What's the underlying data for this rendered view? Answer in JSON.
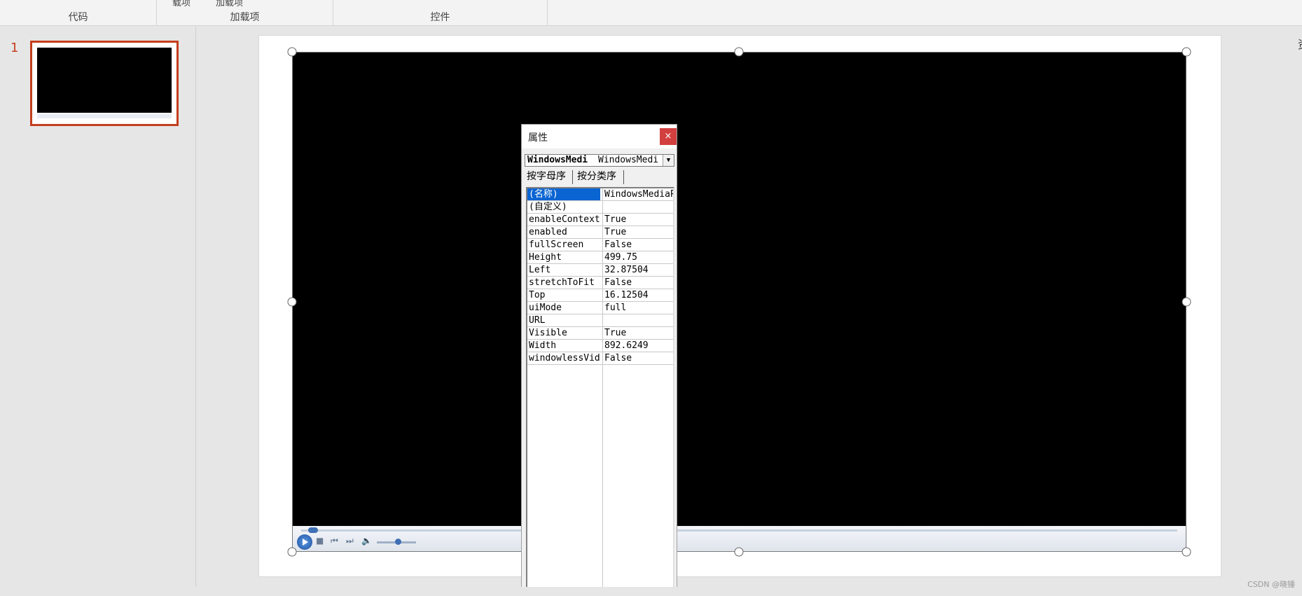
{
  "ribbon": {
    "groups": [
      {
        "label": "代码"
      },
      {
        "label": "加载项",
        "cut_items": [
          "载项",
          "加载项"
        ]
      },
      {
        "label": "控件"
      }
    ]
  },
  "thumbnails": {
    "slide_number": "1"
  },
  "properties_window": {
    "title": "属性",
    "close_glyph": "×",
    "object_name": "WindowsMedi",
    "object_type": "WindowsMedi",
    "dropdown_glyph": "▼",
    "tabs": [
      "按字母序",
      "按分类序"
    ],
    "rows": [
      {
        "key": "(名称)",
        "value": "WindowsMediaP"
      },
      {
        "key": "(自定义)",
        "value": ""
      },
      {
        "key": "enableContext",
        "value": "True"
      },
      {
        "key": "enabled",
        "value": "True"
      },
      {
        "key": "fullScreen",
        "value": "False"
      },
      {
        "key": "Height",
        "value": "499.75"
      },
      {
        "key": "Left",
        "value": "32.87504"
      },
      {
        "key": "stretchToFit",
        "value": "False"
      },
      {
        "key": "Top",
        "value": "16.12504"
      },
      {
        "key": "uiMode",
        "value": "full"
      },
      {
        "key": "URL",
        "value": ""
      },
      {
        "key": "Visible",
        "value": "True"
      },
      {
        "key": "Width",
        "value": "892.6249"
      },
      {
        "key": "windowlessVid",
        "value": "False"
      }
    ]
  },
  "player": {
    "controls": [
      "stop-icon",
      "previous-icon",
      "next-icon",
      "volume-icon"
    ],
    "glyphs": {
      "stop": "■",
      "prev": "⏮",
      "next": "⏭",
      "mute": "🔈"
    }
  },
  "right_edge_text": "资",
  "watermark": "CSDN @晓锤",
  "colors": {
    "accent": "#c43e1c",
    "selection": "#0a64d2",
    "close": "#d23f3f"
  }
}
